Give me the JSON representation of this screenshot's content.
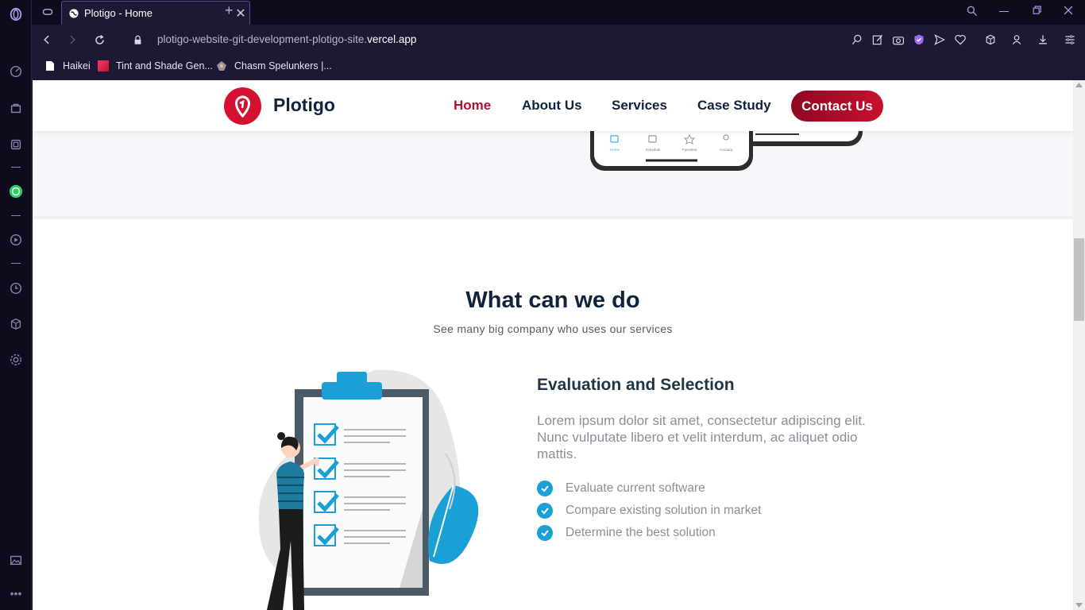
{
  "browser": {
    "tab_title": "Plotigo - Home",
    "tab_close": "✕",
    "new_tab": "+",
    "url_path": "plotigo-website-git-development-plotigo-site.",
    "url_host": "vercel.app",
    "bookmarks": [
      {
        "label": "Haikei",
        "color": "#ffffff"
      },
      {
        "label": "Tint and Shade Gen...",
        "color": "#e8426a"
      },
      {
        "label": "Chasm Spelunkers |...",
        "color": "#9a8fb0"
      }
    ],
    "accent_color": "#b49df0"
  },
  "site": {
    "logo_text": "Plotigo",
    "nav": {
      "home": "Home",
      "about": "About Us",
      "services": "Services",
      "case_study": "Case Study",
      "contact": "Contact Us"
    },
    "brand_color": "#c8102e",
    "section": {
      "title": "What can we do",
      "subtitle": "See many big company who uses our services"
    },
    "feature": {
      "title": "Evaluation and Selection",
      "description": "Lorem ipsum dolor sit amet, consectetur adipiscing elit. Nunc vulputate libero et velit interdum, ac aliquet odio mattis.",
      "checklist": [
        "Evaluate current software",
        "Compare existing solution in market",
        "Determine the best solution"
      ]
    },
    "phone_tabs": [
      "Home",
      "Schedule",
      "Favorites",
      "Account"
    ]
  }
}
